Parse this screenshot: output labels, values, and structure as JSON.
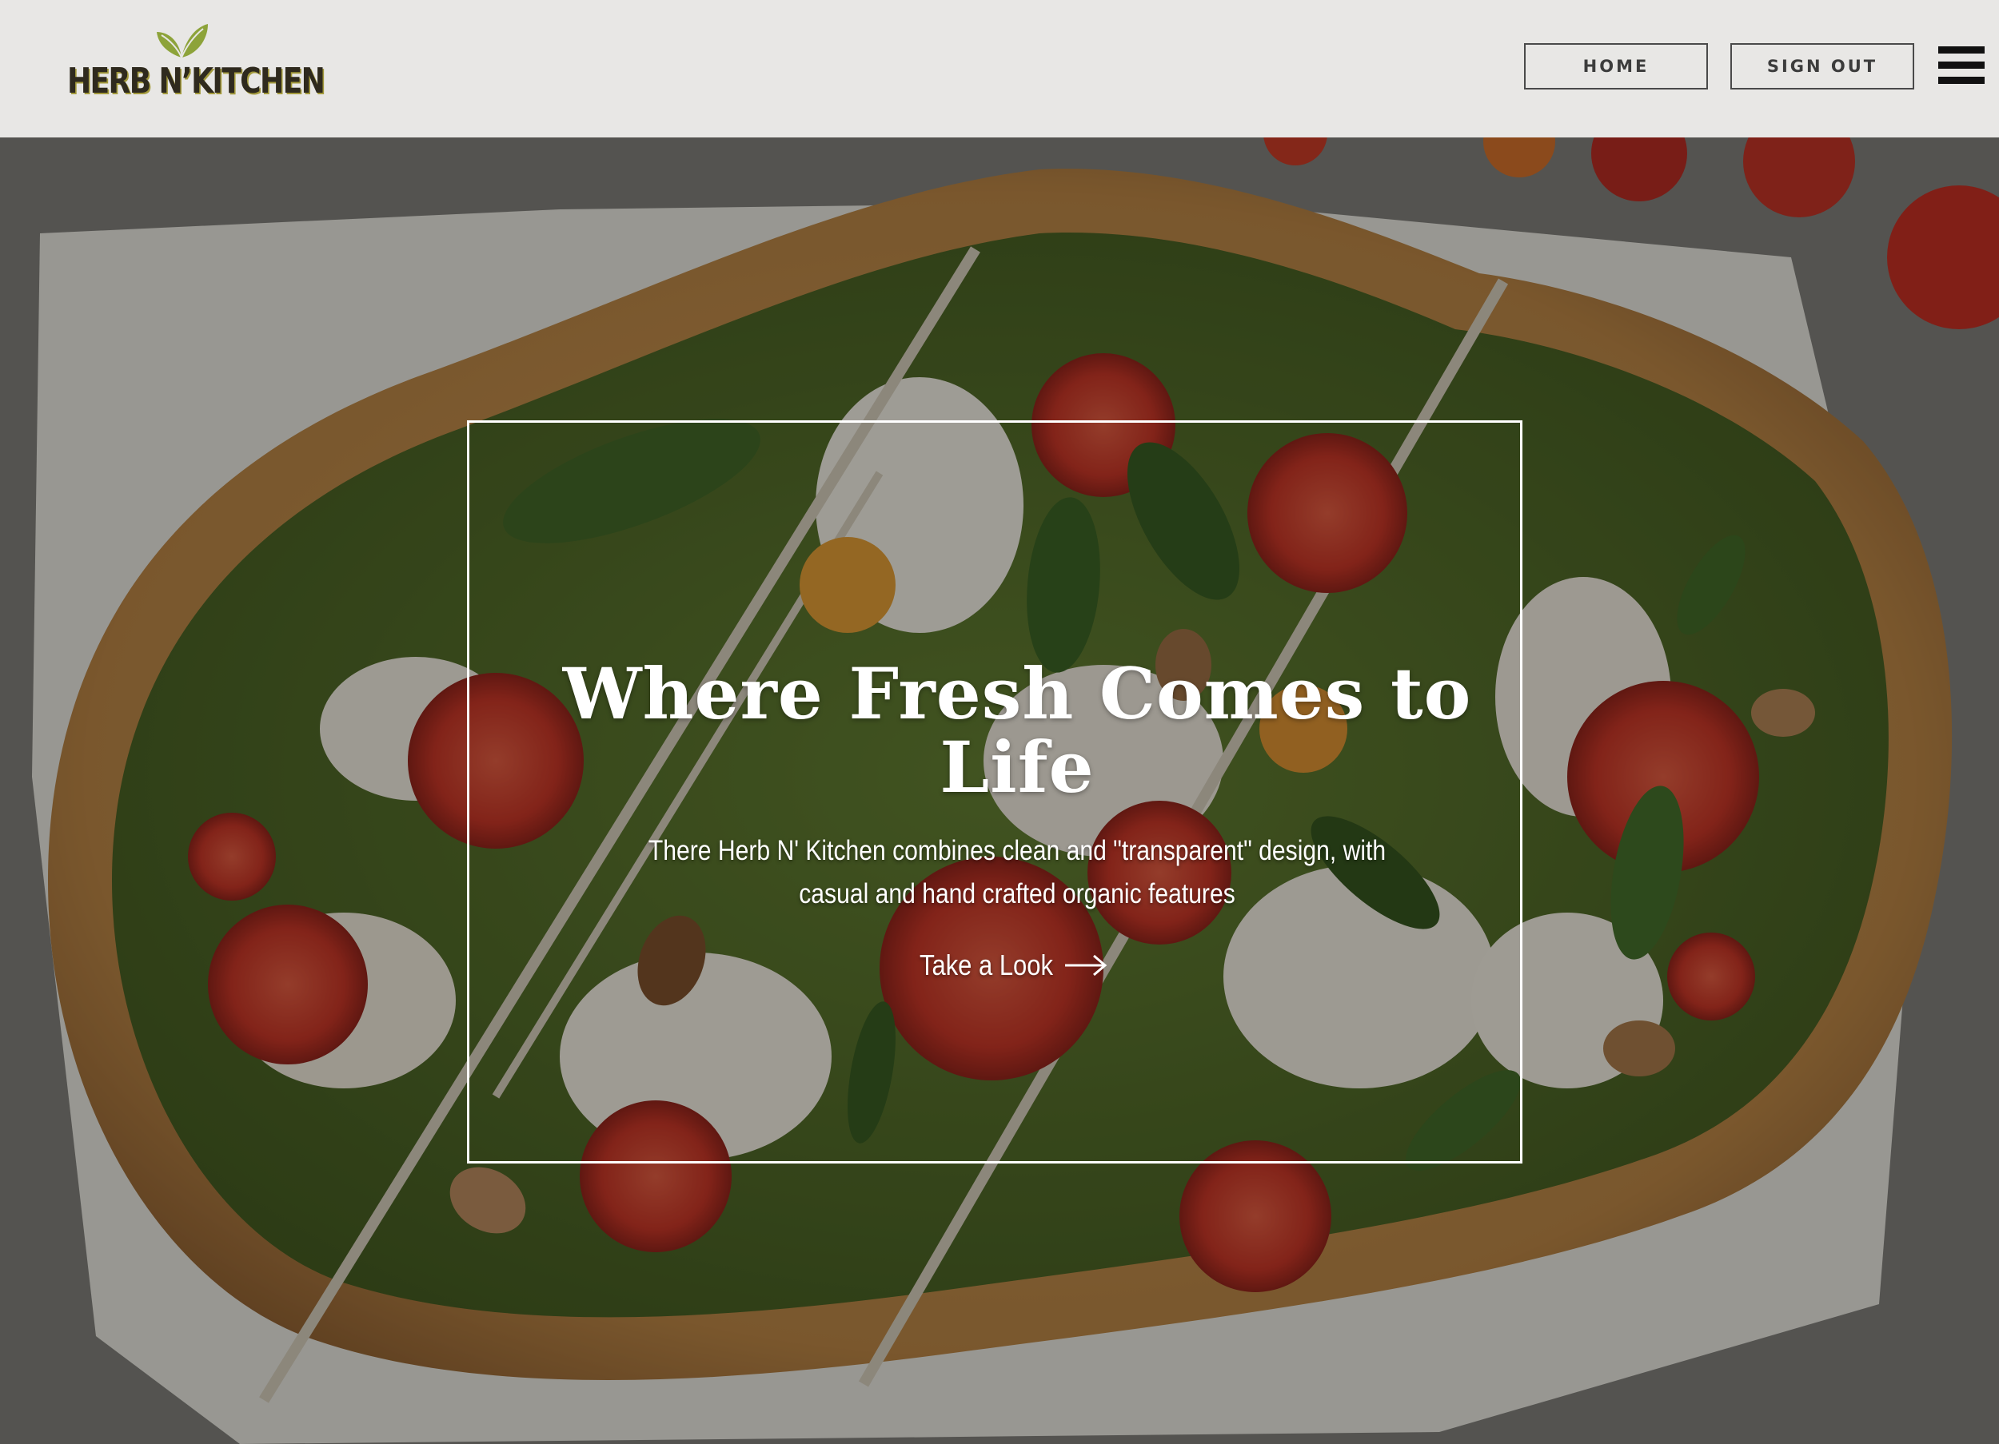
{
  "brand": {
    "logo_text": "HERB N’KITCHEN",
    "primary_color": "#2f2a1e",
    "leaf_color": "#8da33a",
    "leaf_icon": "leaf-icon"
  },
  "header": {
    "nav": {
      "home_label": "HOME",
      "signout_label": "SIGN OUT"
    },
    "menu_icon": "hamburger-menu-icon"
  },
  "hero": {
    "title": "Where Fresh Comes to Life",
    "subtitle": "There Herb N' Kitchen combines clean and \"transparent\" design, with casual and hand crafted organic features",
    "cta_label": "Take a Look",
    "cta_icon": "arrow-right-icon",
    "background_image": "pesto-margherita-flatbread-pizza-photo",
    "frame_color": "#ffffff"
  }
}
